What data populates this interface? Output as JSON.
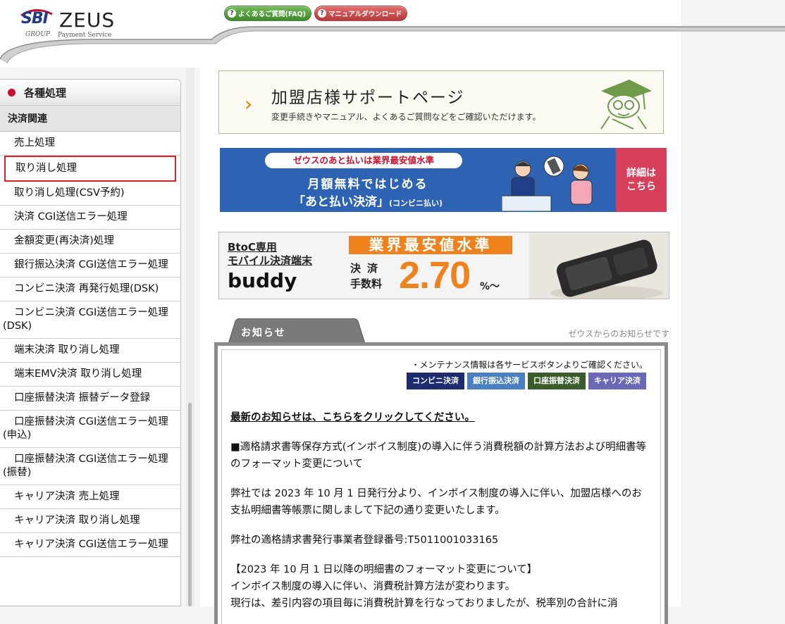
{
  "header": {
    "logo": {
      "sbi": "SBI",
      "zeus": "ZEUS",
      "group": "GROUP",
      "payment_service": "Payment Service"
    },
    "links": [
      {
        "label": "よくあるご質問(FAQ)",
        "icon": "help-icon",
        "color": "#4f9a3a"
      },
      {
        "label": "マニュアルダウンロード",
        "icon": "help-icon",
        "color": "#c84646"
      }
    ]
  },
  "sidebar": {
    "heading": "各種処理",
    "section": "決済関連",
    "items": [
      {
        "label": "売上処理"
      },
      {
        "label": "取り消し処理",
        "highlighted": true
      },
      {
        "label": "取り消し処理(CSV予約)"
      },
      {
        "label": "決済 CGI送信エラー処理"
      },
      {
        "label": "金額変更(再決済)処理"
      },
      {
        "label": "銀行振込決済 CGI送信エラー処理"
      },
      {
        "label": "コンビニ決済 再発行処理(DSK)"
      },
      {
        "label": "コンビニ決済 CGI送信エラー処理(DSK)"
      },
      {
        "label": "端末決済 取り消し処理"
      },
      {
        "label": "端末EMV決済 取り消し処理"
      },
      {
        "label": "口座振替決済 振替データ登録"
      },
      {
        "label": "口座振替決済 CGI送信エラー処理(申込)"
      },
      {
        "label": "口座振替決済 CGI送信エラー処理(振替)"
      },
      {
        "label": "キャリア決済 売上処理"
      },
      {
        "label": "キャリア決済 取り消し処理"
      },
      {
        "label": "キャリア決済 CGI送信エラー処理"
      }
    ]
  },
  "support_banner": {
    "title": "加盟店様サポートページ",
    "subtitle": "変更手続きやマニュアル、よくあるご質問などをご確認いただけます。"
  },
  "ato_banner": {
    "tag": "ゼウスのあと払いは業界最安値水準",
    "line1": "月額無料ではじめる",
    "line2": "「あと払い決済」",
    "line2_small": "(コンビニ払い)",
    "detail_line1": "詳細は",
    "detail_line2": "こちら"
  },
  "buddy_banner": {
    "tag1": "BtoC専用",
    "tag2": "モバイル決済端末",
    "name": "buddy",
    "headline": "業界最安値水準",
    "fee_label1": "決済",
    "fee_label2": "手数料",
    "rate": "2.70",
    "rate_unit": "%～"
  },
  "news": {
    "tab_label": "お知らせ",
    "right_label": "ゼウスからのお知らせです",
    "maintenance_note": "・メンテナンス情報は各サービスボタンよりご確認ください。",
    "service_buttons": [
      {
        "label": "コンビニ決済",
        "color": "#1d2c6e"
      },
      {
        "label": "銀行振込決済",
        "color": "#4a7fc2"
      },
      {
        "label": "口座振替決済",
        "color": "#3a5c2a"
      },
      {
        "label": "キャリア決済",
        "color": "#6b68b8"
      }
    ],
    "latest_link": "最新のお知らせは、こちらをクリックしてください。",
    "para1": "■適格請求書等保存方式(インボイス制度)の導入に伴う消費税額の計算方法および明細書等のフォーマット変更について",
    "para2": "弊社では 2023 年 10 月 1 日発行分より、インボイス制度の導入に伴い、加盟店様へのお支払明細書等帳票に関しまして下記の通り変更いたします。",
    "para3": "弊社の適格請求書発行事業者登録番号:T5011001033165",
    "para4_line1": "【2023 年 10 月 1 日以降の明細書のフォーマット変更について】",
    "para4_line2": "インボイス制度の導入に伴い、消費税計算方法が変わります。",
    "para4_line3": "現行は、差引内容の項目毎に消費税計算を行なっておりましたが、税率別の合計に消"
  }
}
